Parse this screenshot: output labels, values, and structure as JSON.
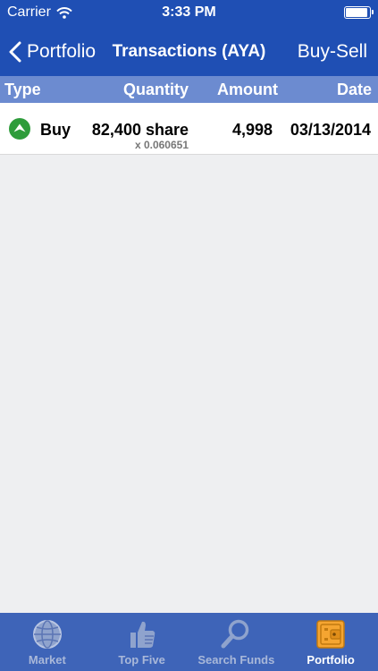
{
  "status": {
    "carrier": "Carrier",
    "time": "3:33 PM"
  },
  "nav": {
    "back_label": "Portfolio",
    "title": "Transactions (AYA)",
    "right_label": "Buy-Sell"
  },
  "columns": {
    "type": "Type",
    "quantity": "Quantity",
    "amount": "Amount",
    "date": "Date"
  },
  "transactions": [
    {
      "type": "Buy",
      "quantity": "82,400 share",
      "price": "x 0.060651",
      "amount": "4,998",
      "date": "03/13/2014",
      "icon": "buy-arrow-icon"
    }
  ],
  "tabs": [
    {
      "label": "Market",
      "icon": "globe-icon",
      "active": false
    },
    {
      "label": "Top Five",
      "icon": "thumbs-up-icon",
      "active": false
    },
    {
      "label": "Search Funds",
      "icon": "magnifier-icon",
      "active": false
    },
    {
      "label": "Portfolio",
      "icon": "wallet-icon",
      "active": true
    }
  ],
  "colors": {
    "navbar": "#1f4fb4",
    "header": "#6c8bd0",
    "tabbar": "#3e64b8",
    "accent_orange": "#f5a531",
    "buy_green": "#2e9c3b"
  }
}
